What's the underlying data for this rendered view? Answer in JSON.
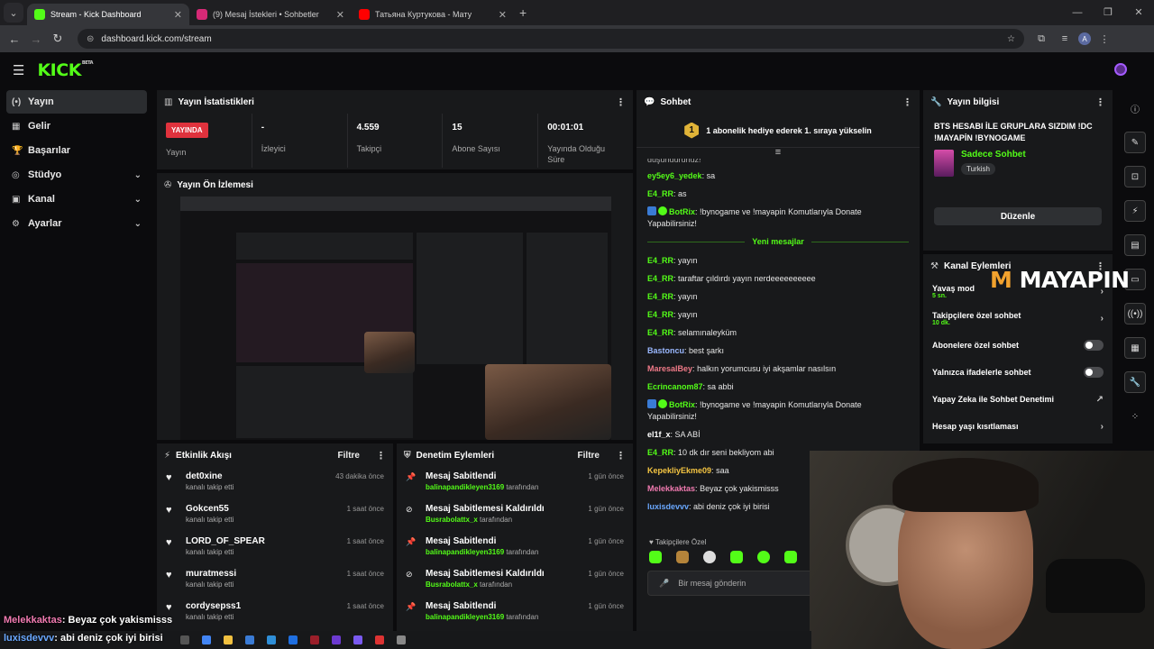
{
  "browser": {
    "tabs": [
      {
        "title": "Stream - Kick Dashboard",
        "active": true,
        "color": "#53fc18"
      },
      {
        "title": "(9) Mesaj İstekleri • Sohbetler",
        "active": false,
        "color": "#d62976"
      },
      {
        "title": "Татьяна Куртукова - Мату",
        "active": false,
        "color": "#ff0000"
      }
    ],
    "url": "dashboard.kick.com/stream",
    "profile_initial": "A"
  },
  "header": {
    "logo": "KICK",
    "beta": "BETA"
  },
  "sidebar": {
    "items": [
      {
        "label": "Yayın",
        "icon": "broadcast-icon",
        "glyph": "(•)",
        "active": true,
        "expand": false
      },
      {
        "label": "Gelir",
        "icon": "revenue-icon",
        "glyph": "▦",
        "active": false,
        "expand": false
      },
      {
        "label": "Başarılar",
        "icon": "trophy-icon",
        "glyph": "🏆",
        "active": false,
        "expand": false
      },
      {
        "label": "Stüdyo",
        "icon": "studio-icon",
        "glyph": "◎",
        "active": false,
        "expand": true
      },
      {
        "label": "Kanal",
        "icon": "channel-icon",
        "glyph": "▣",
        "active": false,
        "expand": true
      },
      {
        "label": "Ayarlar",
        "icon": "settings-icon",
        "glyph": "⚙",
        "active": false,
        "expand": true
      }
    ]
  },
  "stats": {
    "title": "Yayın İstatistikleri",
    "live_badge": "YAYINDA",
    "live_label": "Yayın",
    "viewers_value": "-",
    "viewers_label": "İzleyici",
    "followers_value": "4.559",
    "followers_label": "Takipçi",
    "subs_value": "15",
    "subs_label": "Abone Sayısı",
    "uptime_value": "00:01:01",
    "uptime_label": "Yayında Olduğu Süre"
  },
  "preview": {
    "title": "Yayın Ön İzlemesi"
  },
  "activity": {
    "title": "Etkinlik Akışı",
    "filter": "Filtre",
    "items": [
      {
        "name": "det0xine",
        "action": "kanalı takip etti",
        "time": "43 dakika önce"
      },
      {
        "name": "Gokcen55",
        "action": "kanalı takip etti",
        "time": "1 saat önce"
      },
      {
        "name": "LORD_OF_SPEAR",
        "action": "kanalı takip etti",
        "time": "1 saat önce"
      },
      {
        "name": "muratmessi",
        "action": "kanalı takip etti",
        "time": "1 saat önce"
      },
      {
        "name": "cordysepss1",
        "action": "kanalı takip etti",
        "time": "1 saat önce"
      }
    ]
  },
  "moderation": {
    "title": "Denetim Eylemleri",
    "filter": "Filtre",
    "suffix": "tarafından",
    "items": [
      {
        "action": "Mesaj Sabitlendi",
        "user": "balinapandikleyen3169",
        "time": "1 gün önce",
        "icon": "pin-icon"
      },
      {
        "action": "Mesaj Sabitlemesi Kaldırıldı",
        "user": "Busrabolattx_x",
        "time": "1 gün önce",
        "icon": "unpin-icon"
      },
      {
        "action": "Mesaj Sabitlendi",
        "user": "balinapandikleyen3169",
        "time": "1 gün önce",
        "icon": "pin-icon"
      },
      {
        "action": "Mesaj Sabitlemesi Kaldırıldı",
        "user": "Busrabolattx_x",
        "time": "1 gün önce",
        "icon": "unpin-icon"
      },
      {
        "action": "Mesaj Sabitlendi",
        "user": "balinapandikleyen3169",
        "time": "1 gün önce",
        "icon": "pin-icon"
      }
    ]
  },
  "chat": {
    "title": "Sohbet",
    "banner_num": "1",
    "banner_text": "1 abonelik hediye ederek 1. sıraya yükselin",
    "cut_text": "düşündürünüz!",
    "new_messages": "Yeni mesajlar",
    "before": [
      {
        "user": "ey5ey6_yedek",
        "color": "#53fc18",
        "text": "sa"
      },
      {
        "user": "E4_RR",
        "color": "#53fc18",
        "text": "as"
      },
      {
        "user": "BotRix",
        "color": "#53fc18",
        "text": "!bynogame ve !mayapin Komutlarıyla Donate Yapabilirsiniz!",
        "bot": true
      }
    ],
    "after": [
      {
        "user": "E4_RR",
        "color": "#53fc18",
        "text": "yayın"
      },
      {
        "user": "E4_RR",
        "color": "#53fc18",
        "text": "taraftar çıldırdı yayın nerdeeeeeeeeee"
      },
      {
        "user": "E4_RR",
        "color": "#53fc18",
        "text": "yayın"
      },
      {
        "user": "E4_RR",
        "color": "#53fc18",
        "text": "yayın"
      },
      {
        "user": "E4_RR",
        "color": "#53fc18",
        "text": "selamınaleyküm"
      },
      {
        "user": "Bastoncu",
        "color": "#9ab8ff",
        "text": "best şarkı"
      },
      {
        "user": "MaresalBey",
        "color": "#f07a88",
        "text": "halkın yorumcusu iyi akşamlar nasılsın"
      },
      {
        "user": "Ecrincanom87",
        "color": "#53fc18",
        "text": "sa abbi"
      },
      {
        "user": "BotRix",
        "color": "#53fc18",
        "text": "!bynogame ve !mayapin Komutlarıyla Donate Yapabilirsiniz!",
        "bot": true
      },
      {
        "user": "el1f_x",
        "color": "#ffffff",
        "text": "SA ABİ"
      },
      {
        "user": "E4_RR",
        "color": "#53fc18",
        "text": "10 dk dır seni bekliyom abi"
      },
      {
        "user": "KepekliyEkme09",
        "color": "#f5c542",
        "text": "saa"
      },
      {
        "user": "Melekkaktas",
        "color": "#f07ab0",
        "text": "Beyaz çok yakismisss"
      },
      {
        "user": "luxisdevvv",
        "color": "#6aa8ff",
        "text": "abi deniz çok iyi birisi"
      }
    ],
    "followers_only": "Takipçilere Özel",
    "input_placeholder": "Bir mesaj gönderin"
  },
  "info": {
    "title": "Yayın bilgisi",
    "stream_title": "BTS HESABI İLE GRUPLARA SIZDIM !DC !MAYAPİN !BYNOGAME",
    "category": "Sadece Sohbet",
    "tag": "Turkish",
    "edit": "Düzenle"
  },
  "channel_actions": {
    "title": "Kanal Eylemleri",
    "slow_mode": "Yavaş mod",
    "slow_mode_sub": "5 sn.",
    "followers_chat": "Takipçilere özel sohbet",
    "followers_chat_sub": "10 dk.",
    "subs_chat": "Abonelere özel sohbet",
    "emote_chat": "Yalnızca ifadelerle sohbet",
    "ai_mod": "Yapay Zeka ile Sohbet Denetimi",
    "age_limit": "Hesap yaşı kısıtlaması"
  },
  "watermark": {
    "m": "M",
    "rest": "MAYAPIN"
  },
  "overlay": [
    {
      "user": "Melekkaktas",
      "color": "#f07ab0",
      "text": ": Beyaz çok yakismisss"
    },
    {
      "user": "luxisdevvv",
      "color": "#6aa8ff",
      "text": ": abi deniz çok iyi birisi"
    }
  ],
  "colors": {
    "accent": "#53fc18",
    "live": "#e0323d"
  }
}
